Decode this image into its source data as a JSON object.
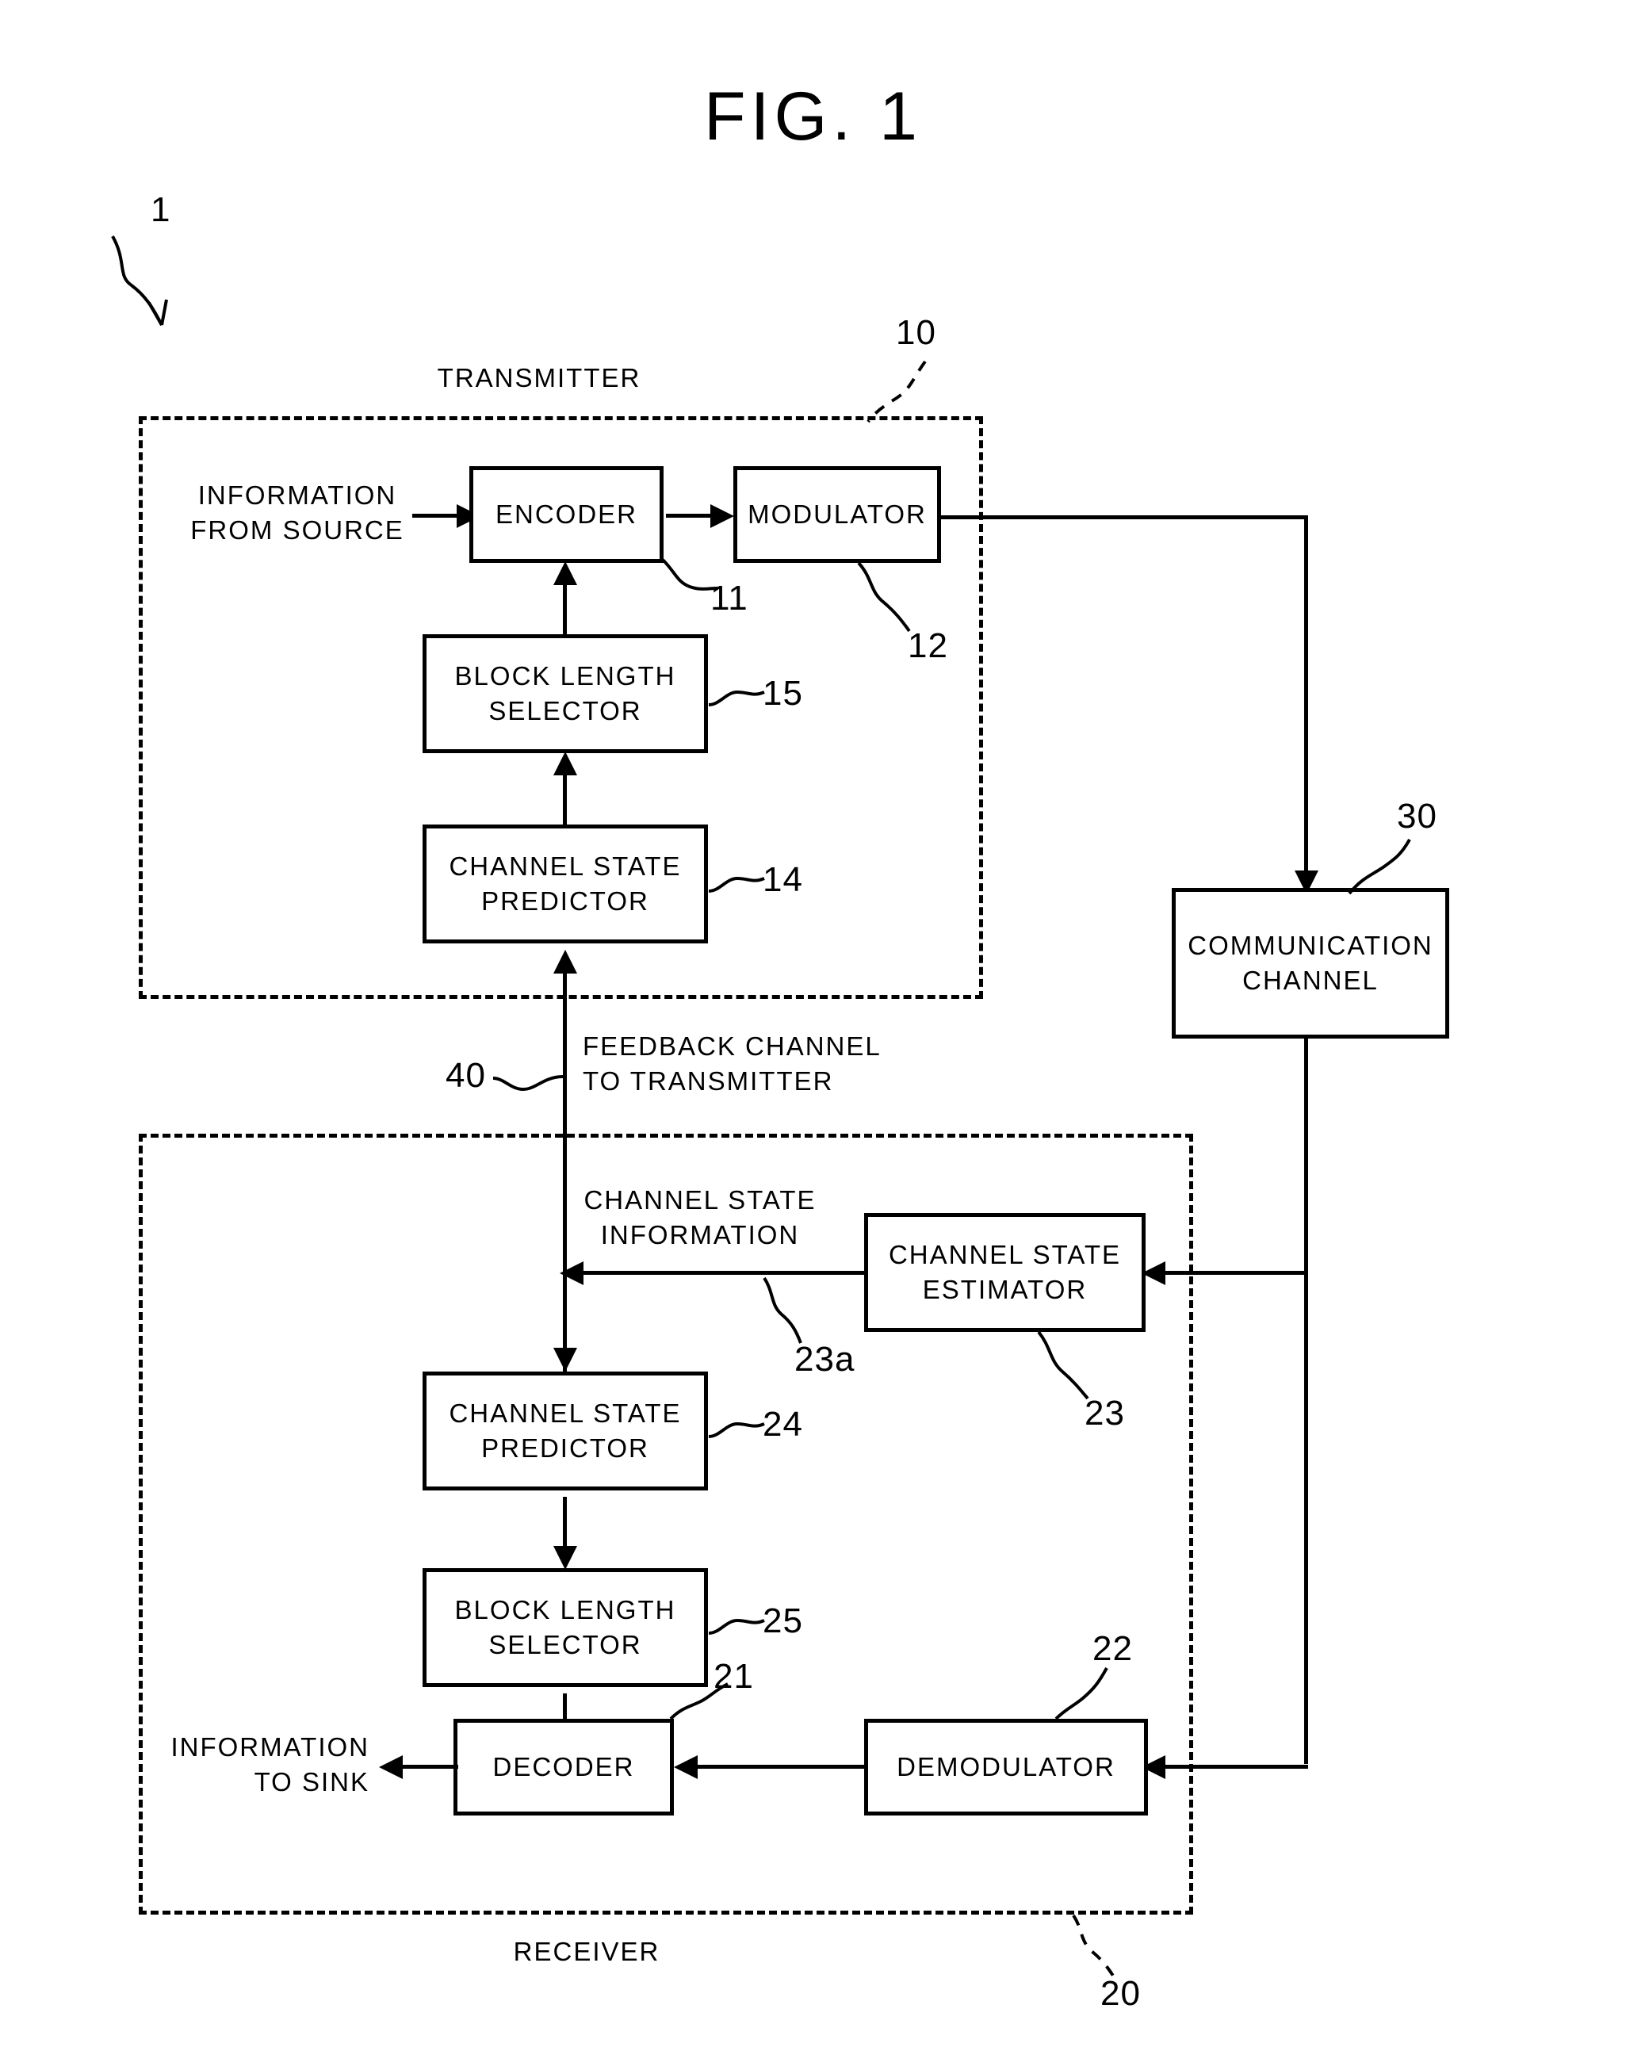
{
  "figure": {
    "title": "FIG. 1",
    "system_ref": "1"
  },
  "groups": {
    "transmitter": {
      "label": "TRANSMITTER",
      "ref": "10"
    },
    "receiver": {
      "label": "RECEIVER",
      "ref": "20"
    }
  },
  "nodes": {
    "encoder": {
      "label": "ENCODER",
      "ref": "11"
    },
    "modulator": {
      "label": "MODULATOR",
      "ref": "12"
    },
    "tx_block_length": {
      "label": "BLOCK LENGTH\nSELECTOR",
      "ref": "15"
    },
    "tx_channel_predictor": {
      "label": "CHANNEL STATE\nPREDICTOR",
      "ref": "14"
    },
    "comm_channel": {
      "label": "COMMUNICATION\nCHANNEL",
      "ref": "30"
    },
    "channel_estimator": {
      "label": "CHANNEL STATE\nESTIMATOR",
      "ref": "23"
    },
    "rx_channel_predictor": {
      "label": "CHANNEL STATE\nPREDICTOR",
      "ref": "24"
    },
    "rx_block_length": {
      "label": "BLOCK LENGTH\nSELECTOR",
      "ref": "25"
    },
    "decoder": {
      "label": "DECODER",
      "ref": "21"
    },
    "demodulator": {
      "label": "DEMODULATOR",
      "ref": "22"
    }
  },
  "signals": {
    "information_from_source": "INFORMATION\nFROM SOURCE",
    "information_to_sink": "INFORMATION\nTO SINK",
    "feedback_channel": "FEEDBACK CHANNEL\nTO TRANSMITTER",
    "feedback_channel_ref": "40",
    "channel_state_information": "CHANNEL STATE\nINFORMATION",
    "channel_state_information_ref": "23a"
  },
  "colors": {
    "ink": "#000000",
    "paper": "#ffffff"
  }
}
